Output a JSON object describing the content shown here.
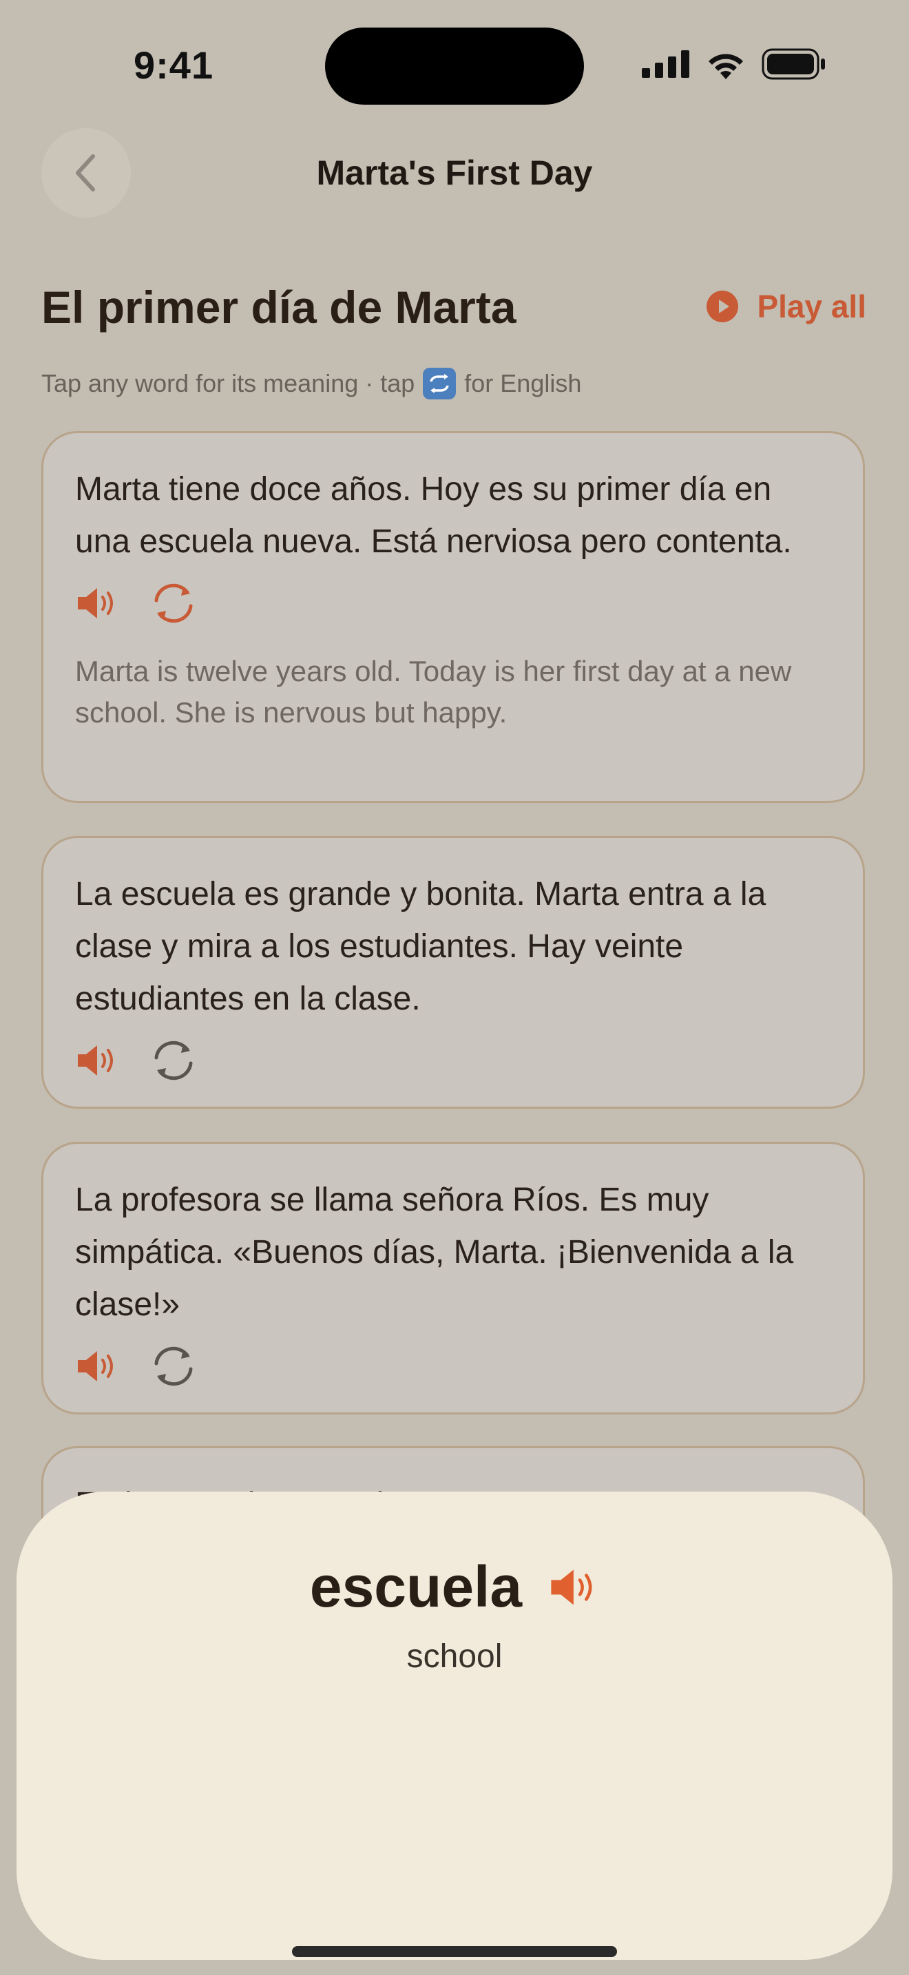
{
  "status_bar": {
    "time": "9:41"
  },
  "nav": {
    "title": "Marta's First Day"
  },
  "header": {
    "story_title": "El primer día de Marta",
    "play_all_label": "Play all",
    "subtitle_before": "Tap any word for its meaning · tap",
    "subtitle_after": "for English"
  },
  "paragraphs": [
    {
      "spanish": "Marta tiene doce años. Hoy es su primer día en una escuela nueva. Está nerviosa pero contenta.",
      "english": "Marta is twelve years old. Today is her first day at a new school. She is nervous but happy.",
      "translation_visible": true
    },
    {
      "spanish": "La escuela es grande y bonita. Marta entra a la clase y mira a los estudiantes. Hay veinte estudiantes en la clase.",
      "translation_visible": false
    },
    {
      "spanish": "La profesora se llama señora Ríos. Es muy simpática. «Buenos días, Marta. ¡Bienvenida a la clase!»",
      "translation_visible": false
    },
    {
      "spanish": "En la escuela Marta ha..."
    }
  ],
  "word_sheet": {
    "word": "escuela",
    "meaning": "school"
  },
  "colors": {
    "accent": "#c85a36",
    "background": "#c4bdb2",
    "card": "#cac5bf",
    "sheet": "#f2ebdb"
  }
}
